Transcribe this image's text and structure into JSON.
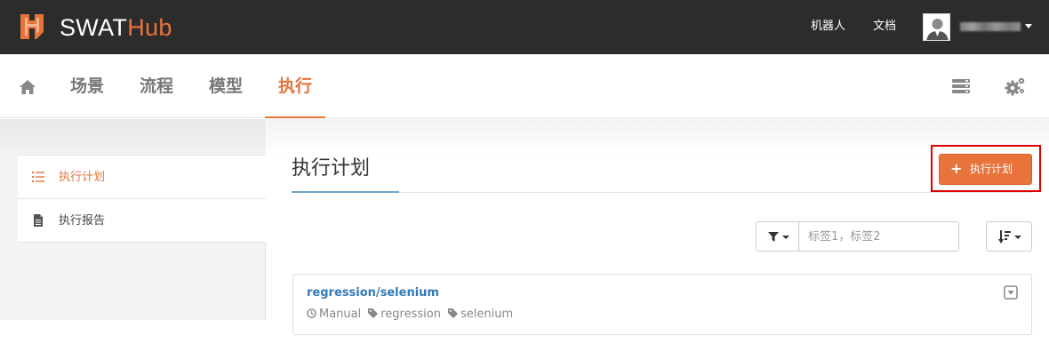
{
  "app": {
    "brand_part1": "SWAT",
    "brand_part2": "Hub",
    "brand_color": "#e8733b",
    "topbar_color": "#2c2c2c"
  },
  "topnav": {
    "links": [
      {
        "label": "机器人"
      },
      {
        "label": "文档"
      }
    ],
    "user": {
      "name": "sqa_chao"
    }
  },
  "subnav": {
    "home_icon": "home-icon",
    "tabs": [
      {
        "label": "场景",
        "active": false
      },
      {
        "label": "流程",
        "active": false
      },
      {
        "label": "模型",
        "active": false
      },
      {
        "label": "执行",
        "active": true
      }
    ],
    "right_icons": [
      "server-list-icon",
      "gears-icon"
    ]
  },
  "sidebar": {
    "items": [
      {
        "label": "执行计划",
        "icon": "list-icon",
        "active": true
      },
      {
        "label": "执行报告",
        "icon": "file-icon",
        "active": false
      }
    ]
  },
  "main": {
    "title": "执行计划",
    "new_button_label": "执行计划",
    "new_button_icon": "plus-icon",
    "filter": {
      "placeholder": "标签1，标签2",
      "value": ""
    }
  },
  "plans": [
    {
      "name": "regression/selenium",
      "mode": "Manual",
      "tags": [
        "regression",
        "selenium"
      ]
    }
  ],
  "colors": {
    "accent": "#e8733b",
    "link": "#337ab7",
    "highlight": "#e00000"
  }
}
